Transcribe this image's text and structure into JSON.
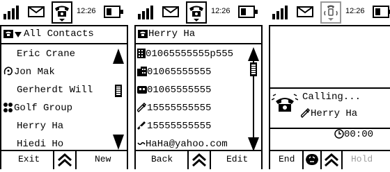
{
  "colors": {
    "ink": "#000000",
    "disabled": "#9e9e9e",
    "background": "#ffffff"
  },
  "screens": [
    {
      "status": {
        "time": "12:26"
      },
      "title": "All Contacts",
      "contacts": [
        {
          "name": "Eric Crane",
          "icon": ""
        },
        {
          "name": "Jon Mak",
          "icon": "person-outline-icon"
        },
        {
          "name": "Gerherdt Will",
          "icon": ""
        },
        {
          "name": "Golf Group",
          "icon": "group-icon"
        },
        {
          "name": "Herry Ha",
          "icon": ""
        },
        {
          "name": "Hiedi Ho",
          "icon": ""
        }
      ],
      "softkeys": {
        "left": "Exit",
        "right": "New"
      }
    },
    {
      "status": {
        "time": "12:26"
      },
      "title": "Herry Ha",
      "entries": [
        {
          "value": "01065555555p555",
          "icon": "office-building-icon"
        },
        {
          "value": "01065555555",
          "icon": "home-building-icon"
        },
        {
          "value": "01065555555",
          "icon": "fax-icon"
        },
        {
          "value": "15555555555",
          "icon": "mobile-phone-icon"
        },
        {
          "value": "15555555555",
          "icon": "mobile-phone-alt-icon"
        },
        {
          "value": "HaHa@yahoo.com",
          "icon": "email-icon"
        }
      ],
      "softkeys": {
        "left": "Back",
        "right": "Edit"
      }
    },
    {
      "status": {
        "time": "12:26"
      },
      "call": {
        "status": "Calling...",
        "name": "Herry Ha",
        "timer": "00:00"
      },
      "softkeys": {
        "left": "End",
        "right": "Hold"
      }
    }
  ]
}
